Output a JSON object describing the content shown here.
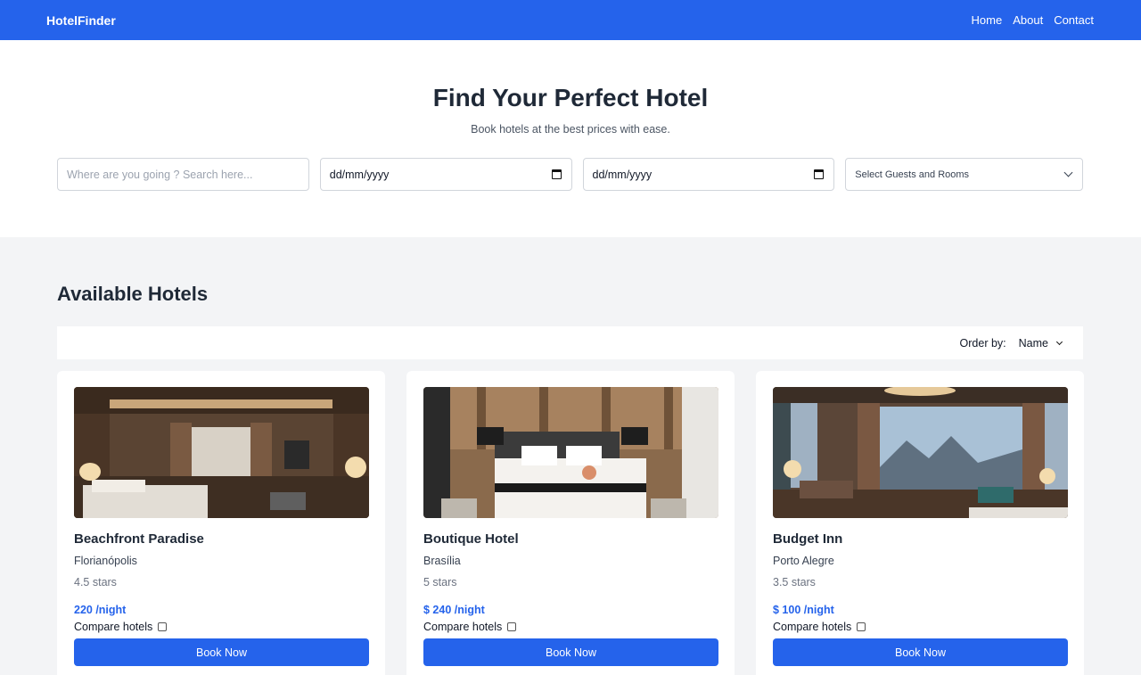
{
  "nav": {
    "brand": "HotelFinder",
    "links": [
      "Home",
      "About",
      "Contact"
    ]
  },
  "hero": {
    "title": "Find Your Perfect Hotel",
    "subtitle": "Book hotels at the best prices with ease."
  },
  "search": {
    "placeholder": "Where are you going ? Search here...",
    "checkin": "dd/mm/yyyy",
    "checkout": "dd/mm/yyyy",
    "guests": "Select Guests and Rooms"
  },
  "listing": {
    "title": "Available Hotels",
    "order_label": "Order by:",
    "order_value": "Name"
  },
  "hotels": [
    {
      "name": "Beachfront Paradise",
      "city": "Florianópolis",
      "stars": "4.5 stars",
      "price": "220 /night",
      "compare": "Compare hotels",
      "book": "Book Now"
    },
    {
      "name": "Boutique Hotel",
      "city": "Brasília",
      "stars": "5 stars",
      "price": "$ 240 /night",
      "compare": "Compare hotels",
      "book": "Book Now"
    },
    {
      "name": "Budget Inn",
      "city": "Porto Alegre",
      "stars": "3.5 stars",
      "price": "$ 100 /night",
      "compare": "Compare hotels",
      "book": "Book Now"
    }
  ],
  "colors": {
    "primary": "#2563eb",
    "background": "#f3f4f6"
  }
}
